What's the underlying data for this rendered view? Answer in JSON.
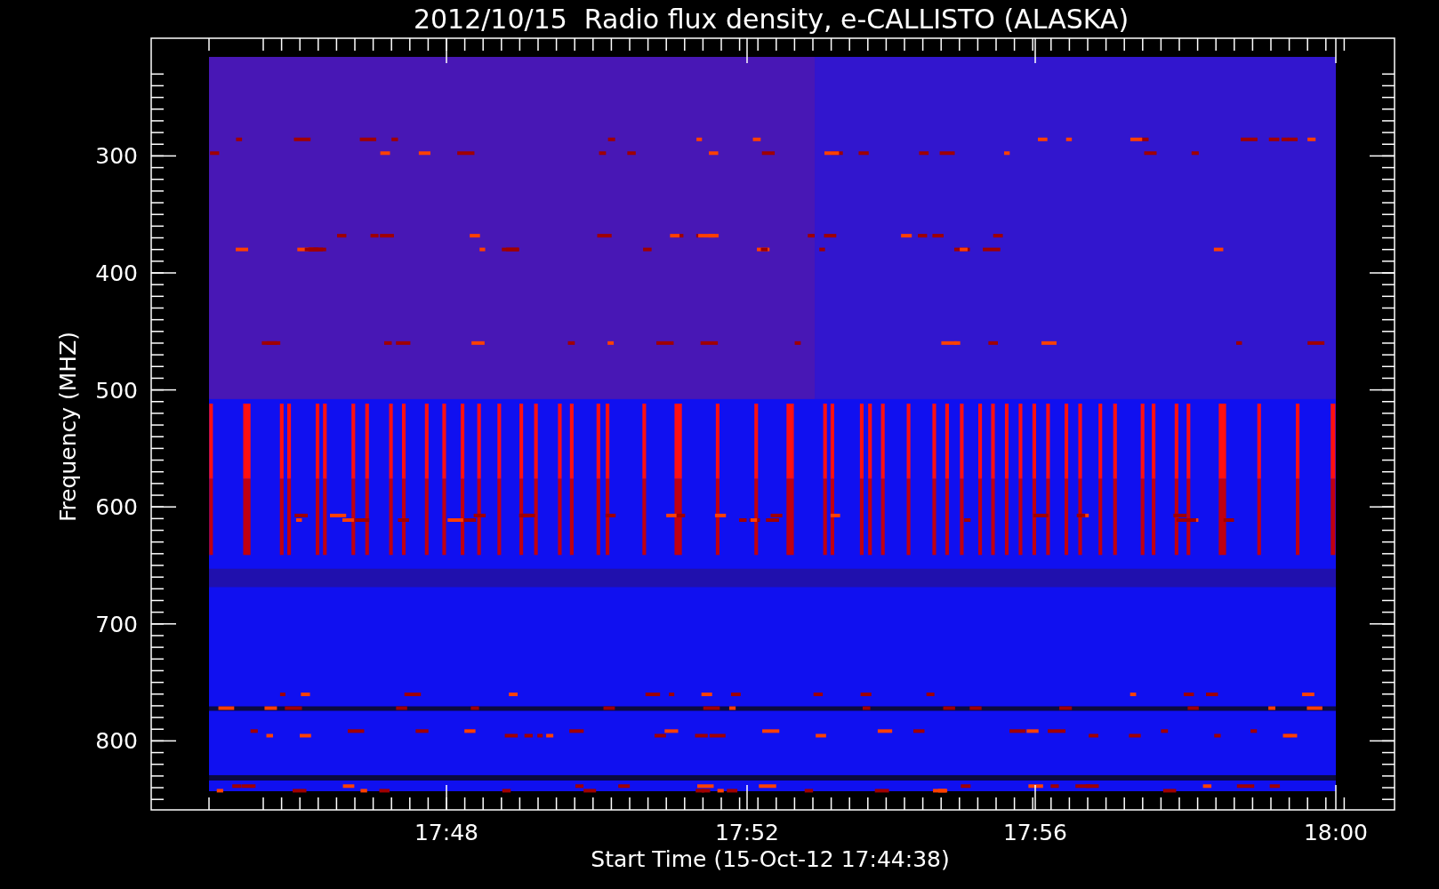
{
  "title": "2012/10/15  Radio flux density, e-CALLISTO (ALASKA)",
  "y_axis": {
    "label": "Frequency (MHZ)",
    "ticks": [
      "300",
      "400",
      "500",
      "600",
      "700",
      "800"
    ]
  },
  "x_axis": {
    "label": "Start Time (15-Oct-12 17:44:38)",
    "ticks": [
      "17:48",
      "17:52",
      "17:56",
      "18:00"
    ]
  }
}
